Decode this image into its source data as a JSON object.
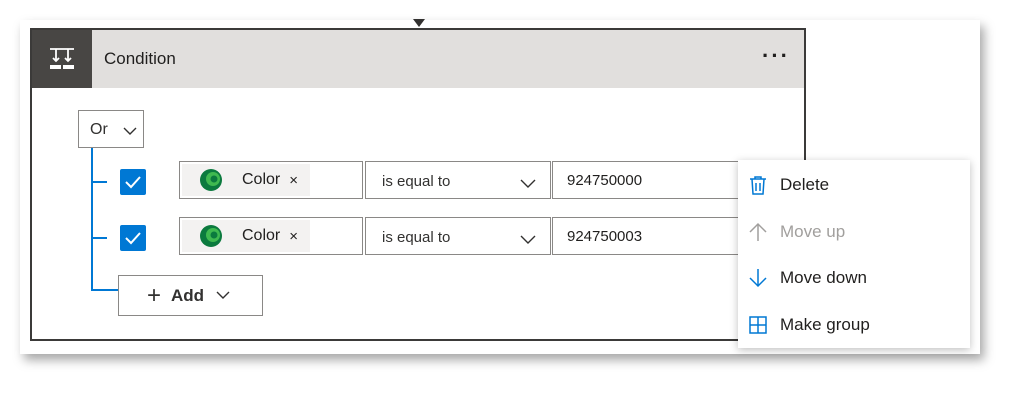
{
  "card": {
    "title": "Condition",
    "more_label": "···"
  },
  "group": {
    "operator_value": "Or"
  },
  "rows": [
    {
      "checked": true,
      "token_label": "Color",
      "token_remove": "×",
      "operator": "is equal to",
      "value": "924750000"
    },
    {
      "checked": true,
      "token_label": "Color",
      "token_remove": "×",
      "operator": "is equal to",
      "value": "924750003"
    }
  ],
  "add_button": {
    "plus": "+",
    "label": "Add"
  },
  "context_menu": {
    "items": [
      {
        "label": "Delete",
        "icon": "trash-icon",
        "enabled": true
      },
      {
        "label": "Move up",
        "icon": "arrow-up-icon",
        "enabled": false
      },
      {
        "label": "Move down",
        "icon": "arrow-down-icon",
        "enabled": true
      },
      {
        "label": "Make group",
        "icon": "grid-icon",
        "enabled": true
      }
    ]
  },
  "colors": {
    "accent": "#0078d4",
    "header_bg": "#e1dfdd",
    "icon_tile_bg": "#484644",
    "dataverse_green": "#0b7a3e"
  }
}
